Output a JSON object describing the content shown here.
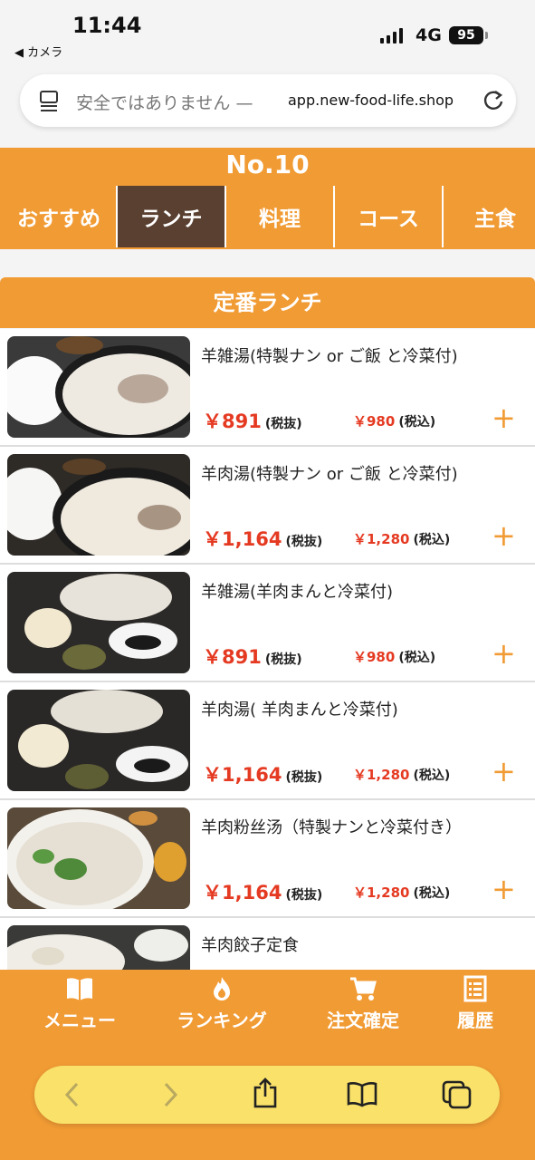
{
  "status": {
    "time": "11:44",
    "back_app": "◀ カメラ",
    "network": "4G",
    "battery": "95"
  },
  "browser": {
    "insecure_label": "安全ではありません —",
    "domain": "app.new-food-life.shop"
  },
  "header": {
    "store_no": "No.10",
    "tabs": [
      "おすすめ",
      "ランチ",
      "料理",
      "コース",
      "主食"
    ],
    "active_tab": "ランチ"
  },
  "section": {
    "title": "定番ランチ"
  },
  "menu": {
    "items": [
      {
        "name": "羊雑湯(特製ナン or ご飯 と冷菜付)",
        "price": "￥891",
        "price_note": "(税抜)",
        "price_tax": "￥980",
        "tax_note": "(税込)"
      },
      {
        "name": "羊肉湯(特製ナン or ご飯 と冷菜付)",
        "price": "￥1,164",
        "price_note": "(税抜)",
        "price_tax": "￥1,280",
        "tax_note": "(税込)"
      },
      {
        "name": "羊雑湯(羊肉まんと冷菜付)",
        "price": "￥891",
        "price_note": "(税抜)",
        "price_tax": "￥980",
        "tax_note": "(税込)"
      },
      {
        "name": "羊肉湯( 羊肉まんと冷菜付)",
        "price": "￥1,164",
        "price_note": "(税抜)",
        "price_tax": "￥1,280",
        "tax_note": "(税込)"
      },
      {
        "name": "羊肉粉丝汤（特製ナンと冷菜付き）",
        "price": "￥1,164",
        "price_note": "(税抜)",
        "price_tax": "￥1,280",
        "tax_note": "(税込)"
      },
      {
        "name": "羊肉餃子定食",
        "price": "",
        "price_note": "",
        "price_tax": "",
        "tax_note": ""
      }
    ],
    "add_symbol": "+"
  },
  "bottom_nav": {
    "items": [
      {
        "label": "メニュー",
        "icon": "book-icon"
      },
      {
        "label": "ランキング",
        "icon": "flame-icon"
      },
      {
        "label": "注文確定",
        "icon": "cart-icon"
      },
      {
        "label": "履歴",
        "icon": "list-icon"
      }
    ]
  },
  "colors": {
    "accent": "#f19b34",
    "active_tab": "#5a4030",
    "price": "#e53a22",
    "safari_bar": "#f9e16a"
  }
}
